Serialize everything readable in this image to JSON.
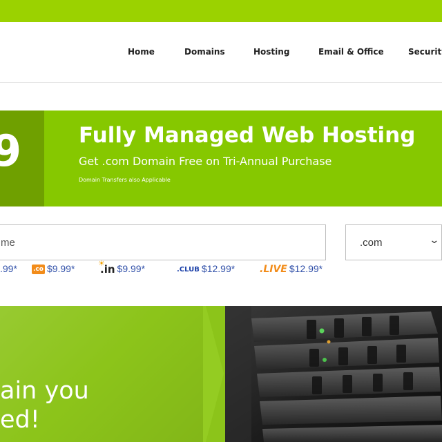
{
  "nav": {
    "items": [
      {
        "label": "Home"
      },
      {
        "label": "Domains"
      },
      {
        "label": "Hosting"
      },
      {
        "label": "Email & Office"
      },
      {
        "label": "Security"
      }
    ]
  },
  "banner": {
    "price_fragment": "9",
    "title": "Fully Managed Web Hosting",
    "subtitle": "Get .com Domain Free on Tri-Annual Purchase",
    "note": "Domain Transfers also Applicable"
  },
  "search": {
    "placeholder": "me",
    "selected_tld": ".com"
  },
  "tld_prices": [
    {
      "ext": "",
      "price": ".99*"
    },
    {
      "ext": ".co",
      "price": "$9.99*"
    },
    {
      "ext": ".in",
      "price": "$9.99*"
    },
    {
      "ext": ".CLUB",
      "price": "$12.99*"
    },
    {
      "ext": ".LIVE",
      "price": "$12.99*"
    }
  ],
  "hero": {
    "line1": "ain you",
    "line2": "ed!"
  },
  "colors": {
    "brand_green": "#9bd200",
    "banner_green": "#86c800",
    "banner_dark": "#6fa000",
    "price_blue": "#2f4fa8"
  }
}
